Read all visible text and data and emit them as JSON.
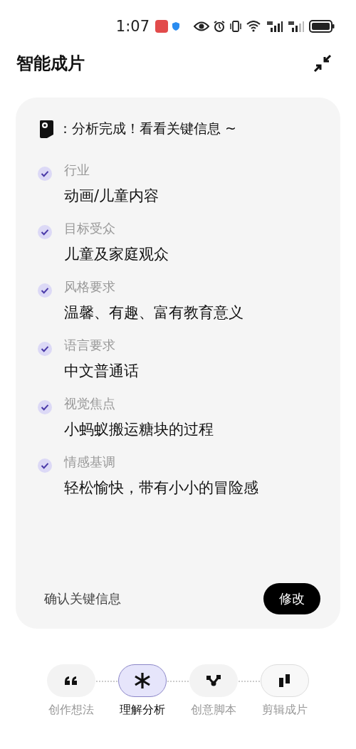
{
  "status_bar": {
    "time": "1:07"
  },
  "header": {
    "title": "智能成片"
  },
  "card": {
    "message": "：分析完成！看看关键信息 ~",
    "items": [
      {
        "label": "行业",
        "value": "动画/儿童内容",
        "checked": true
      },
      {
        "label": "目标受众",
        "value": "儿童及家庭观众",
        "checked": true
      },
      {
        "label": "风格要求",
        "value": "温馨、有趣、富有教育意义",
        "checked": true
      },
      {
        "label": "语言要求",
        "value": "中文普通话",
        "checked": true
      },
      {
        "label": "视觉焦点",
        "value": "小蚂蚁搬运糖块的过程",
        "checked": true
      },
      {
        "label": "情感基调",
        "value": "轻松愉快，带有小小的冒险感",
        "checked": true
      }
    ],
    "confirm_text": "确认关键信息",
    "edit_button": "修改"
  },
  "steps": [
    {
      "label": "创作想法",
      "kind": "quote",
      "selected": false
    },
    {
      "label": "理解分析",
      "kind": "asterisk",
      "selected": true
    },
    {
      "label": "创意脚本",
      "kind": "branch",
      "selected": false
    },
    {
      "label": "剪辑成片",
      "kind": "bars",
      "selected": false
    }
  ]
}
